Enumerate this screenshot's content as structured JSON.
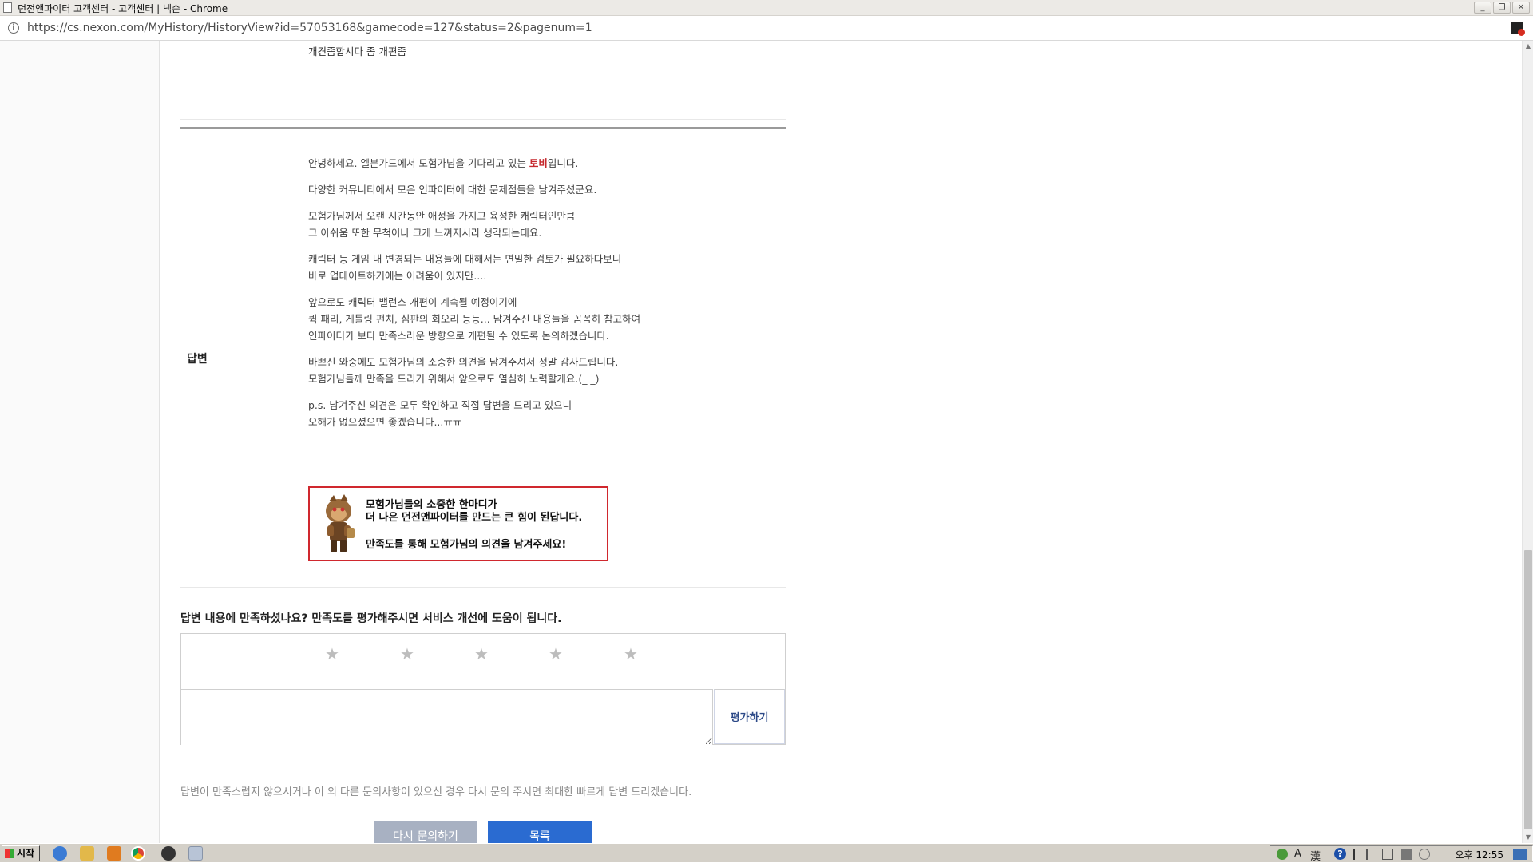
{
  "window": {
    "title": "던전앤파이터 고객센터 - 고객센터 | 넥슨 - Chrome",
    "minimize": "_",
    "restore": "❐",
    "close": "✕"
  },
  "address": {
    "url": "https://cs.nexon.com/MyHistory/HistoryView?id=57053168&gamecode=127&status=2&pagenum=1"
  },
  "question": {
    "text": "개견좀합시다 좀 개편좀"
  },
  "answer": {
    "label": "답변",
    "intro_before": "안녕하세요. 엘븐가드에서 모험가님을 기다리고 있는 ",
    "intro_name": "토비",
    "intro_after": "입니다.",
    "paragraphs": [
      [
        "다양한 커뮤니티에서 모은 인파이터에 대한 문제점들을 남겨주셨군요."
      ],
      [
        "모험가님께서 오랜 시간동안 애정을 가지고 육성한 캐릭터인만큼",
        "그 아쉬움 또한 무척이나 크게 느껴지시라 생각되는데요."
      ],
      [
        "캐릭터 등 게임 내 변경되는 내용들에 대해서는 면밀한 검토가 필요하다보니",
        "바로 업데이트하기에는 어려움이 있지만...."
      ],
      [
        "앞으로도 캐릭터 밸런스 개편이 계속될 예정이기에",
        "퀵 패리, 게틀링 펀치, 심판의 회오리 등등... 남겨주신 내용들을 꼼꼼히 참고하여",
        "인파이터가 보다 만족스러운 방향으로 개편될 수 있도록 논의하겠습니다."
      ],
      [
        "바쁘신 와중에도 모험가님의 소중한 의견을 남겨주셔서 정말 감사드립니다.",
        "모험가님들께 만족을 드리기 위해서 앞으로도 열심히 노력할게요.(_ _)"
      ],
      [
        "p.s. 남겨주신 의견은 모두 확인하고 직접 답변을 드리고 있으니",
        "오해가 없으셨으면 좋겠습니다...ㅠㅠ"
      ]
    ],
    "banner": {
      "line1": "모험가님들의 소중한 한마디가",
      "line2": "더 나은 던전앤파이터를 만드는 큰 힘이 된답니다.",
      "line3": "만족도를 통해 모험가님의 의견을 남겨주세요!"
    }
  },
  "rating": {
    "question": "답변 내용에 만족하셨나요? 만족도를 평가해주시면 서비스 개선에 도움이 됩니다.",
    "stars": [
      "★",
      "★",
      "★",
      "★",
      "★"
    ],
    "star_count": 5,
    "selected": 0,
    "comment_value": "",
    "submit_label": "평가하기"
  },
  "footer": {
    "note": "답변이 만족스럽지 않으시거나 이 외 다른 문의사항이 있으신 경우 다시 문의 주시면 최대한 빠르게 답변 드리겠습니다.",
    "reask_label": "다시 문의하기",
    "list_label": "목록"
  },
  "scrollbar": {
    "up": "▲",
    "down": "▼"
  },
  "taskbar": {
    "start_label": "시작",
    "tray_lang": "A",
    "tray_hanja": "漢",
    "tray_help": "?",
    "clock": "오후 12:55"
  },
  "colors": {
    "highlight": "#c6282d",
    "banner_border": "#d0282e",
    "list_button": "#2a6bd1",
    "reask_button": "#a8b1c2",
    "rate_button_text": "#2d4a88"
  }
}
